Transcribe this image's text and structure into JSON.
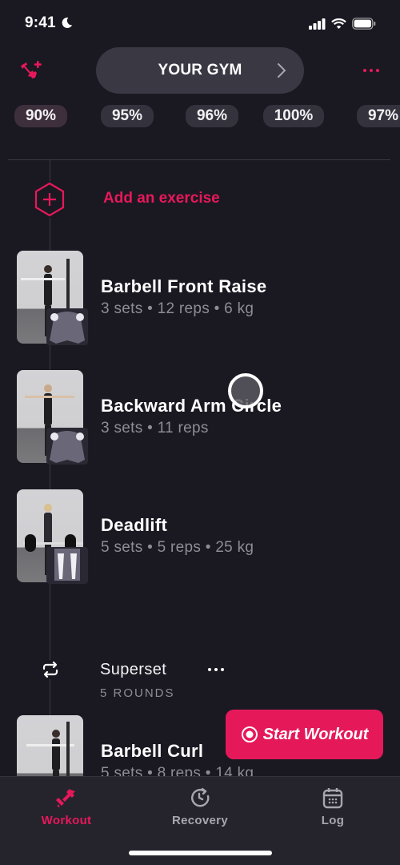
{
  "status_bar": {
    "time": "9:41"
  },
  "header": {
    "gym_label": "YOUR GYM"
  },
  "percent_strip": [
    "90%",
    "95%",
    "96%",
    "100%",
    "97%"
  ],
  "add_exercise": {
    "label": "Add an exercise"
  },
  "exercises": [
    {
      "name": "Barbell Front Raise",
      "meta": "3 sets • 12 reps • 6 kg"
    },
    {
      "name": "Backward Arm Circle",
      "meta": "3 sets • 11 reps"
    },
    {
      "name": "Deadlift",
      "meta": "5 sets • 5 reps • 25 kg"
    }
  ],
  "superset": {
    "label": "Superset",
    "rounds": "5 ROUNDS",
    "exercises": [
      {
        "name": "Barbell Curl",
        "meta": "5 sets • 8 reps • 14 kg"
      }
    ]
  },
  "start_button": {
    "label": "Start Workout"
  },
  "tab_bar": {
    "tabs": [
      {
        "label": "Workout",
        "icon": "dumbbell-icon",
        "active": true
      },
      {
        "label": "Recovery",
        "icon": "recovery-clock-icon",
        "active": false
      },
      {
        "label": "Log",
        "icon": "calendar-icon",
        "active": false
      }
    ]
  },
  "colors": {
    "accent": "#e8185a",
    "background": "#1a1922",
    "pill": "#393843",
    "muted_text": "#8e8c97"
  }
}
